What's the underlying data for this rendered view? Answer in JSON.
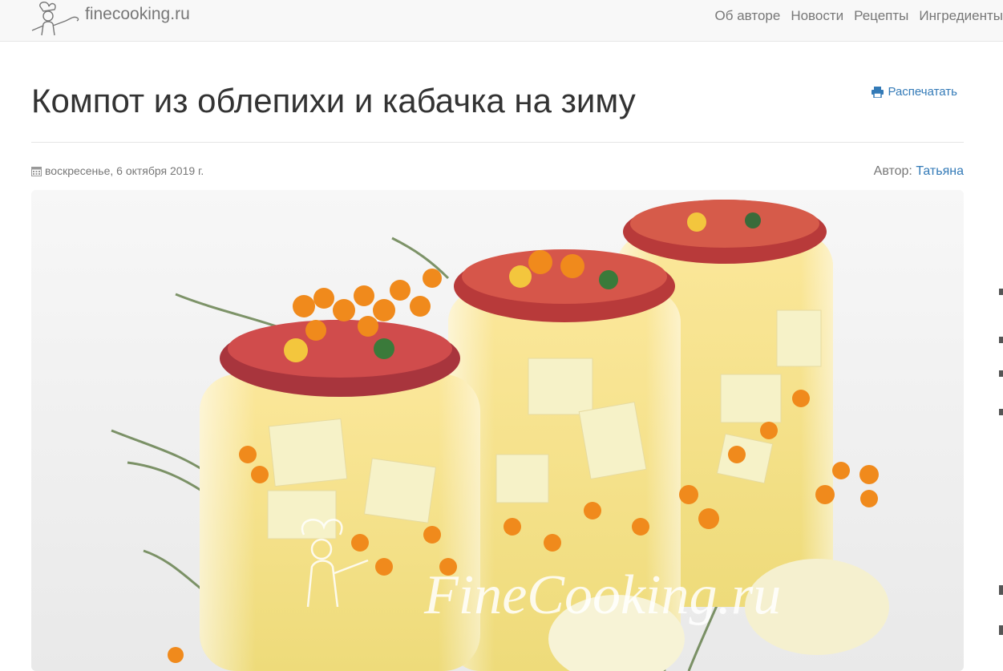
{
  "header": {
    "site_name": "finecooking.ru",
    "nav": [
      {
        "label": "Об авторе"
      },
      {
        "label": "Новости"
      },
      {
        "label": "Рецепты"
      },
      {
        "label": "Ингредиенты"
      }
    ]
  },
  "article": {
    "title": "Компот из облепихи и кабачка на зиму",
    "print_label": "Распечатать",
    "date": "воскресенье, 6 октября 2019 г.",
    "author_label": "Автор:",
    "author_name": "Татьяна",
    "image_watermark": "FineCooking.ru"
  },
  "colors": {
    "link": "#337ab7",
    "muted": "#777777",
    "navbar_bg": "#f8f8f8"
  },
  "icons": {
    "logo": "chef-logo",
    "print": "print-icon",
    "date": "calendar-icon"
  }
}
